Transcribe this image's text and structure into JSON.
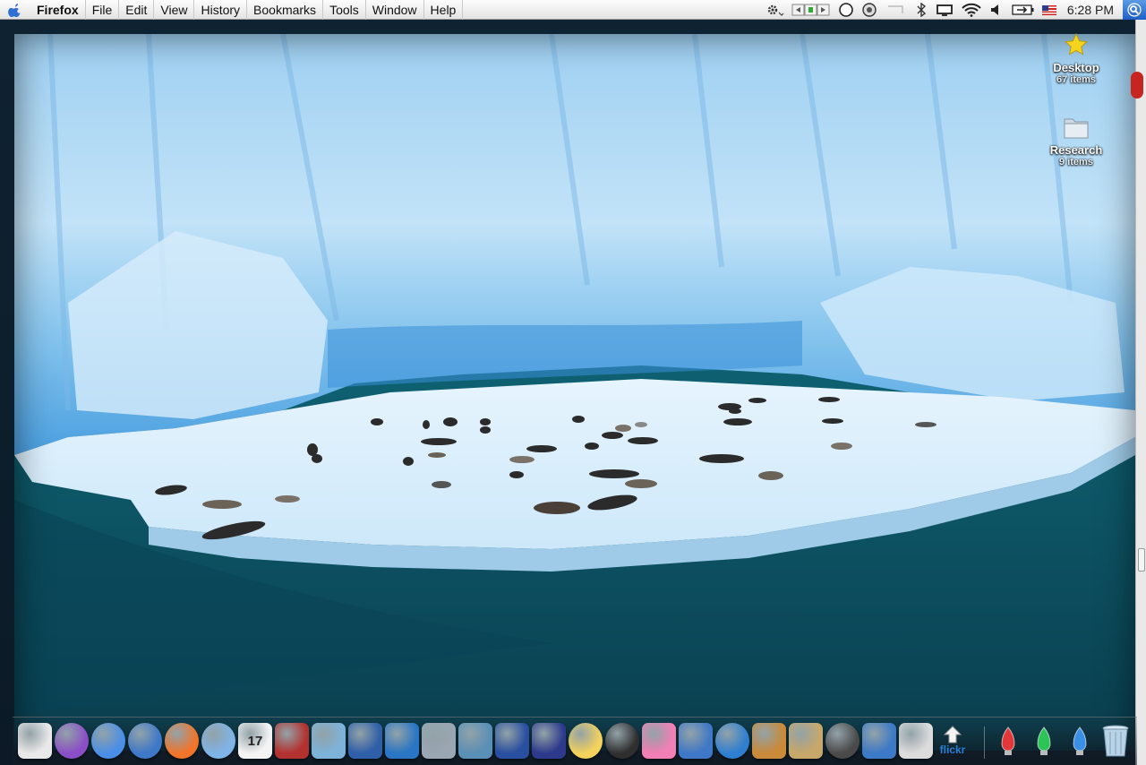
{
  "menubar": {
    "app_name": "Firefox",
    "menus": [
      "File",
      "Edit",
      "View",
      "History",
      "Bookmarks",
      "Tools",
      "Window",
      "Help"
    ],
    "clock": "6:28 PM",
    "status_icons": [
      "script-gear-icon",
      "media-controls-icon",
      "circle-status-icon",
      "time-machine-icon",
      "display-icon",
      "bluetooth-icon",
      "display-mirror-icon",
      "wifi-icon",
      "volume-icon",
      "battery-icon",
      "input-flag-icon",
      "spotlight-icon"
    ]
  },
  "desktop_icons": [
    {
      "label": "Desktop",
      "sub": "67 items",
      "icon": "star-icon"
    },
    {
      "label": "Research",
      "sub": "9 items",
      "icon": "folder-icon"
    }
  ],
  "dock": {
    "apps": [
      {
        "name": "finder-icon",
        "color": "#e9e9e9"
      },
      {
        "name": "messaging-icon",
        "color": "#8a4fc7"
      },
      {
        "name": "ichat-icon",
        "color": "#4a8fe7"
      },
      {
        "name": "safari-icon",
        "color": "#3d78c9"
      },
      {
        "name": "fruit-app-icon",
        "color": "#f0752b"
      },
      {
        "name": "itunes-icon",
        "color": "#7fb4e8"
      },
      {
        "name": "ical-icon",
        "color": "#f4f4f4",
        "text": "17"
      },
      {
        "name": "mail-stamp-icon",
        "color": "#b3322f"
      },
      {
        "name": "preview-icon",
        "color": "#7db3d9"
      },
      {
        "name": "photo-viewer-icon",
        "color": "#2f5fa8"
      },
      {
        "name": "network-icon",
        "color": "#2a76c4"
      },
      {
        "name": "disk-utility-icon",
        "color": "#9aa6b2"
      },
      {
        "name": "iphoto-icon",
        "color": "#5a8fb6"
      },
      {
        "name": "movie-strip-icon",
        "color": "#284fa0"
      },
      {
        "name": "imovie-star-icon",
        "color": "#2d3a8c"
      },
      {
        "name": "pinwheel-icon",
        "color": "#f4d25c"
      },
      {
        "name": "camera-lens-icon",
        "color": "#2f2f2f"
      },
      {
        "name": "flower-icon",
        "color": "#f27fb5"
      },
      {
        "name": "clapboard-icon",
        "color": "#3f78c6"
      },
      {
        "name": "dvd-player-icon",
        "color": "#2f7fd1"
      },
      {
        "name": "garageband-icon",
        "color": "#c98a3a"
      },
      {
        "name": "pages-doc-icon",
        "color": "#c8a86a"
      },
      {
        "name": "fire-icon",
        "color": "#4a4a4a"
      },
      {
        "name": "xcode-icon",
        "color": "#3c79c6"
      },
      {
        "name": "system-profiler-icon",
        "color": "#dcdcdc"
      }
    ],
    "flickr_label": "flickr",
    "right": [
      {
        "name": "red-bulb-icon",
        "color": "#e2383a"
      },
      {
        "name": "green-bulb-icon",
        "color": "#2cc357"
      },
      {
        "name": "blue-bulb-icon",
        "color": "#3a8fe7"
      },
      {
        "name": "trash-icon",
        "color": "#9cc0d8"
      }
    ]
  }
}
